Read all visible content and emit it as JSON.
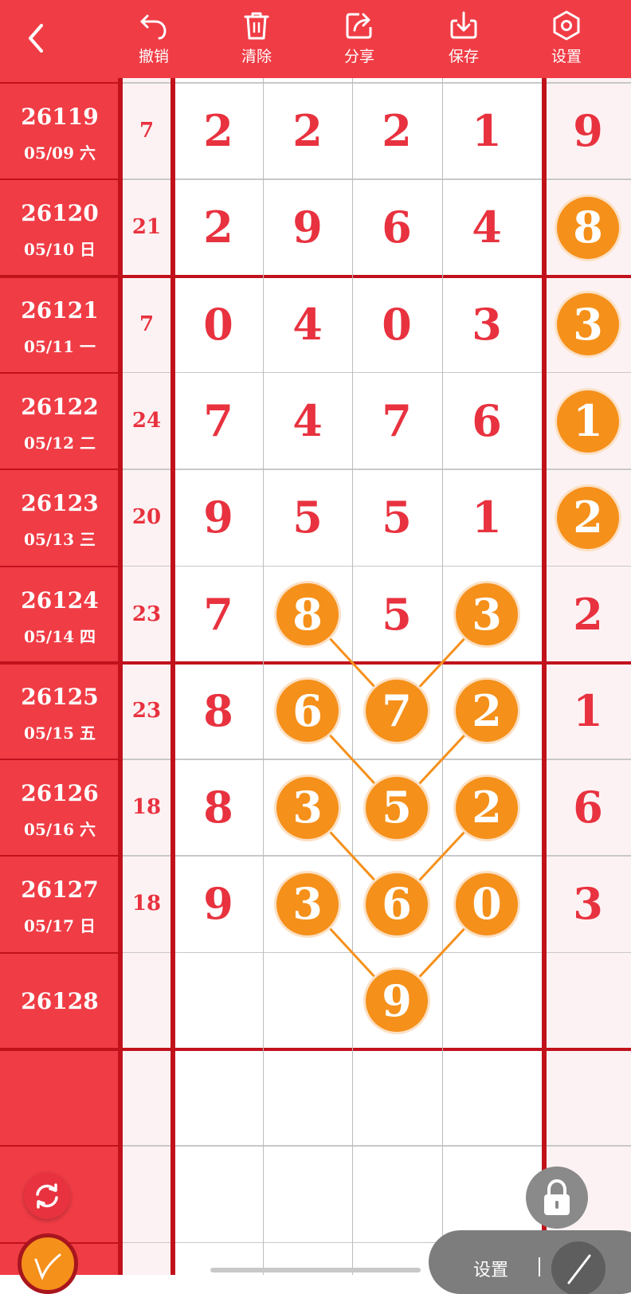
{
  "toolbar": {
    "back": "back",
    "buttons": [
      {
        "label": "撤销",
        "icon": "undo-icon"
      },
      {
        "label": "清除",
        "icon": "trash-icon"
      },
      {
        "label": "分享",
        "icon": "share-icon"
      },
      {
        "label": "保存",
        "icon": "download-icon"
      },
      {
        "label": "设置",
        "icon": "settings-icon"
      }
    ]
  },
  "colors": {
    "red": "#f03c45",
    "digit": "#e8323f",
    "ball": "#f5901a",
    "line": "#f5901a"
  },
  "rows": [
    {
      "issue": "26119",
      "date": "05/09 六",
      "sum": "7",
      "d": [
        "2",
        "2",
        "2",
        "1"
      ],
      "r": "9",
      "hl": [
        false,
        false,
        false,
        false
      ],
      "rhl": false
    },
    {
      "issue": "26120",
      "date": "05/10 日",
      "sum": "21",
      "d": [
        "2",
        "9",
        "6",
        "4"
      ],
      "r": "8",
      "hl": [
        false,
        false,
        false,
        false
      ],
      "rhl": true
    },
    {
      "issue": "26121",
      "date": "05/11 一",
      "sum": "7",
      "d": [
        "0",
        "4",
        "0",
        "3"
      ],
      "r": "3",
      "hl": [
        false,
        false,
        false,
        false
      ],
      "rhl": true
    },
    {
      "issue": "26122",
      "date": "05/12 二",
      "sum": "24",
      "d": [
        "7",
        "4",
        "7",
        "6"
      ],
      "r": "1",
      "hl": [
        false,
        false,
        false,
        false
      ],
      "rhl": true
    },
    {
      "issue": "26123",
      "date": "05/13 三",
      "sum": "20",
      "d": [
        "9",
        "5",
        "5",
        "1"
      ],
      "r": "2",
      "hl": [
        false,
        false,
        false,
        false
      ],
      "rhl": true
    },
    {
      "issue": "26124",
      "date": "05/14 四",
      "sum": "23",
      "d": [
        "7",
        "8",
        "5",
        "3"
      ],
      "r": "2",
      "hl": [
        false,
        true,
        false,
        true
      ],
      "rhl": false
    },
    {
      "issue": "26125",
      "date": "05/15 五",
      "sum": "23",
      "d": [
        "8",
        "6",
        "7",
        "2"
      ],
      "r": "1",
      "hl": [
        false,
        true,
        true,
        true
      ],
      "rhl": false
    },
    {
      "issue": "26126",
      "date": "05/16 六",
      "sum": "18",
      "d": [
        "8",
        "3",
        "5",
        "2"
      ],
      "r": "6",
      "hl": [
        false,
        true,
        true,
        true
      ],
      "rhl": false
    },
    {
      "issue": "26127",
      "date": "05/17 日",
      "sum": "18",
      "d": [
        "9",
        "3",
        "6",
        "0"
      ],
      "r": "3",
      "hl": [
        false,
        true,
        true,
        true
      ],
      "rhl": false
    },
    {
      "issue": "26128",
      "date": "",
      "sum": "",
      "d": [
        "",
        "",
        "9",
        ""
      ],
      "r": "",
      "hl": [
        false,
        false,
        true,
        false
      ],
      "rhl": false
    }
  ],
  "connections": [
    [
      [
        5,
        1
      ],
      [
        6,
        2
      ]
    ],
    [
      [
        5,
        3
      ],
      [
        6,
        2
      ]
    ],
    [
      [
        6,
        1
      ],
      [
        7,
        2
      ]
    ],
    [
      [
        6,
        3
      ],
      [
        7,
        2
      ]
    ],
    [
      [
        7,
        1
      ],
      [
        8,
        2
      ]
    ],
    [
      [
        7,
        3
      ],
      [
        8,
        2
      ]
    ],
    [
      [
        8,
        1
      ],
      [
        9,
        2
      ]
    ],
    [
      [
        8,
        3
      ],
      [
        9,
        2
      ]
    ]
  ],
  "bottom": {
    "tool_label": "设置",
    "lock_icon": "lock-icon",
    "refresh_icon": "refresh-icon",
    "pen_icon": "pen-icon"
  }
}
